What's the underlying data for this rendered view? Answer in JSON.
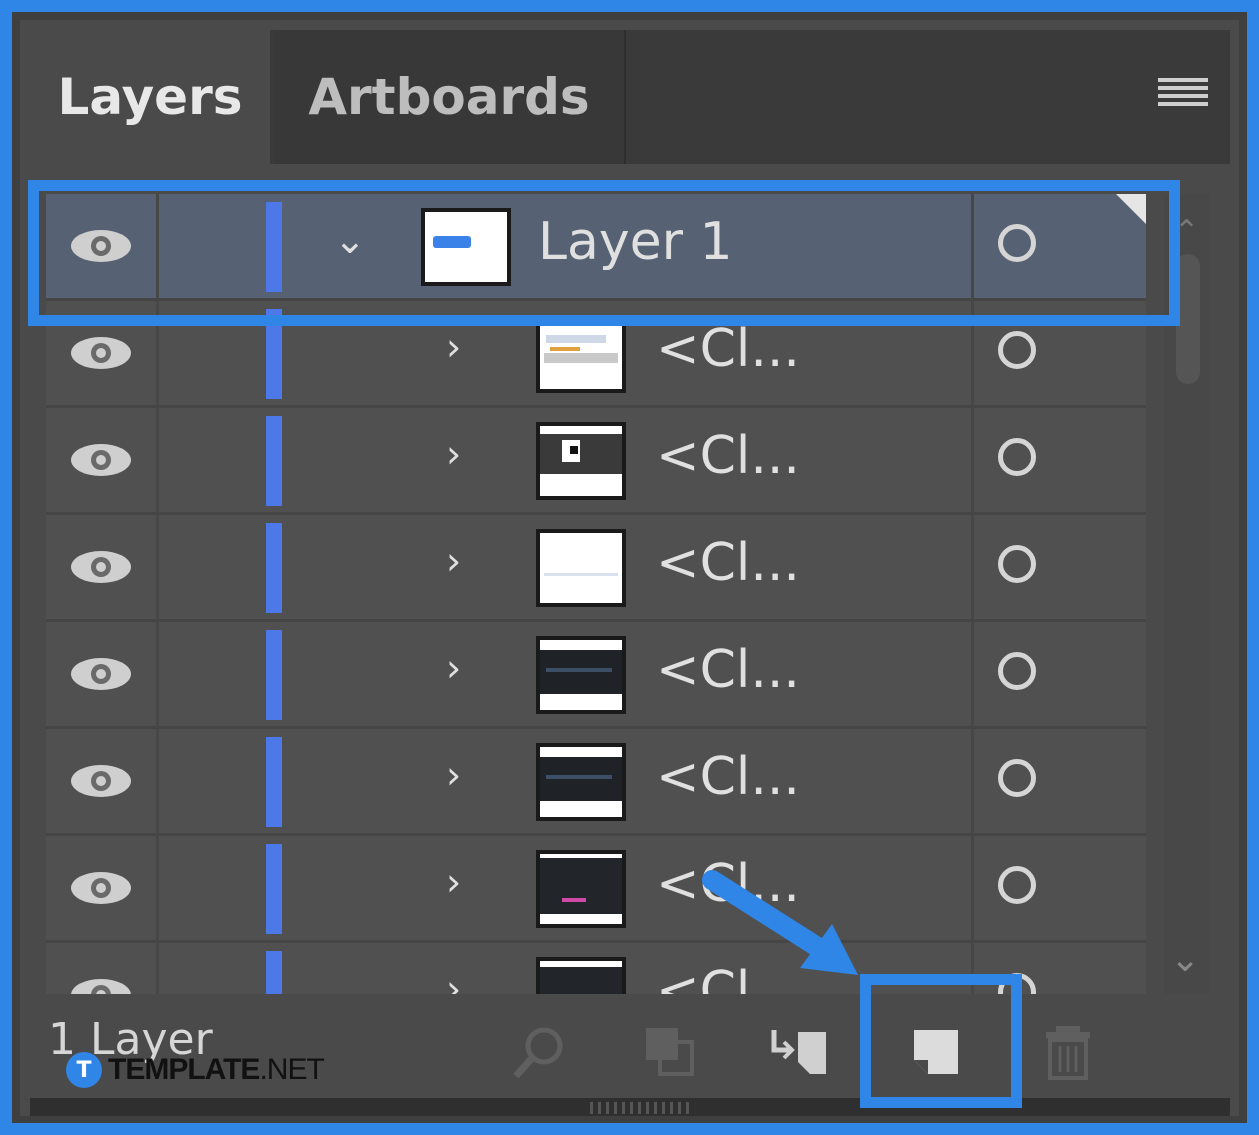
{
  "tabs": [
    {
      "label": "Layers",
      "active": true
    },
    {
      "label": "Artboards",
      "active": false
    }
  ],
  "panel_menu_icon": "hamburger-menu-icon",
  "layers": [
    {
      "name": "Layer 1",
      "level": 0,
      "expanded": true,
      "selected": true
    },
    {
      "name": "<Cl...",
      "level": 1,
      "expanded": false,
      "selected": false
    },
    {
      "name": "<Cl...",
      "level": 1,
      "expanded": false,
      "selected": false
    },
    {
      "name": "<Cl...",
      "level": 1,
      "expanded": false,
      "selected": false
    },
    {
      "name": "<Cl...",
      "level": 1,
      "expanded": false,
      "selected": false
    },
    {
      "name": "<Cl...",
      "level": 1,
      "expanded": false,
      "selected": false
    },
    {
      "name": "<Cl...",
      "level": 1,
      "expanded": false,
      "selected": false
    },
    {
      "name": "<Cl",
      "level": 1,
      "expanded": false,
      "selected": false
    }
  ],
  "footer": {
    "layer_count": "1 Layer",
    "buttons": [
      "search-icon",
      "collect-for-export-icon",
      "move-to-layer-icon",
      "create-new-layer-icon",
      "trash-icon"
    ]
  },
  "colors": {
    "highlight": "#2f86e6",
    "layer_color": "#4d79e8",
    "selected_row": "#566273"
  },
  "watermark": {
    "badge": "T",
    "brand": "TEMPLATE",
    "suffix": ".NET"
  }
}
